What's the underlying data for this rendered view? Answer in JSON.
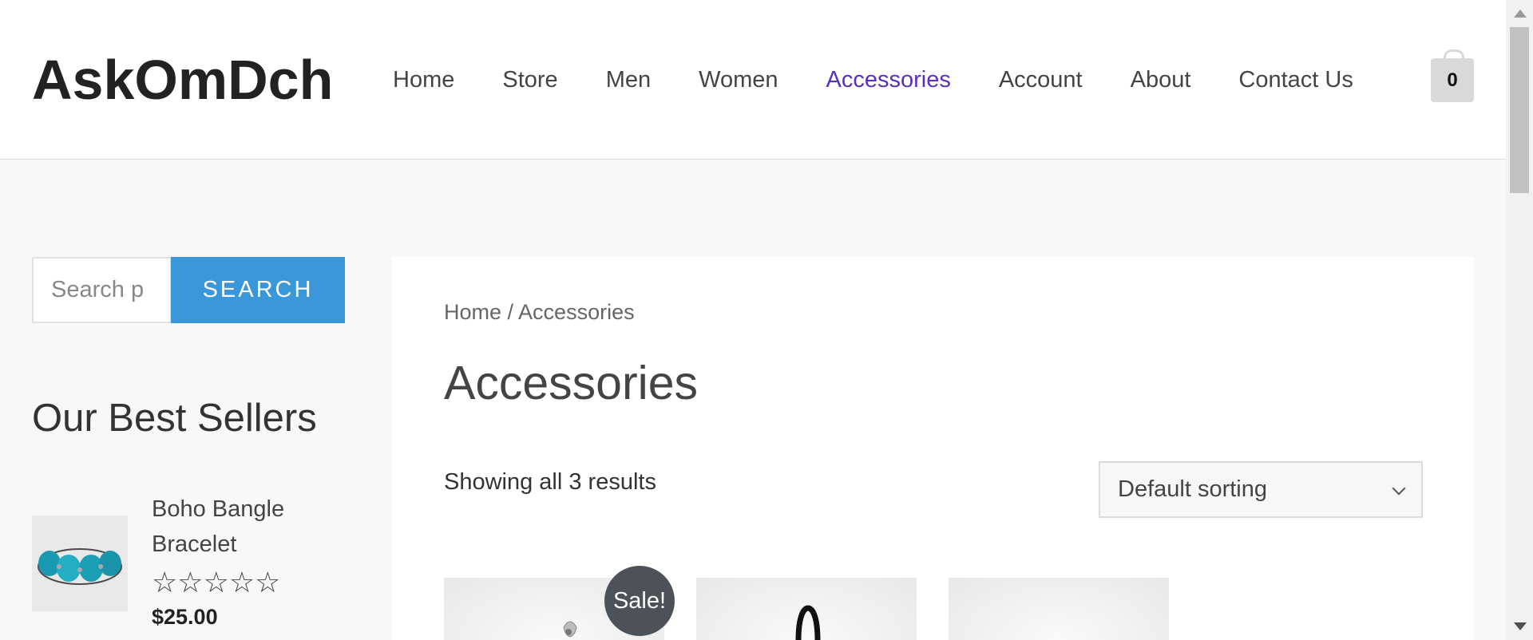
{
  "header": {
    "site_title": "AskOmDch",
    "nav": [
      {
        "label": "Home",
        "active": false
      },
      {
        "label": "Store",
        "active": false
      },
      {
        "label": "Men",
        "active": false
      },
      {
        "label": "Women",
        "active": false
      },
      {
        "label": "Accessories",
        "active": true
      },
      {
        "label": "Account",
        "active": false
      },
      {
        "label": "About",
        "active": false
      },
      {
        "label": "Contact Us",
        "active": false
      }
    ],
    "cart_count": "0"
  },
  "sidebar": {
    "search_placeholder": "Search p",
    "search_button": "SEARCH",
    "widget_title": "Our Best Sellers",
    "best_seller": {
      "name": "Boho Bangle Bracelet",
      "rating_stars": 0,
      "price": "$25.00"
    }
  },
  "main": {
    "breadcrumb_home": "Home",
    "breadcrumb_sep": " / ",
    "breadcrumb_current": "Accessories",
    "title": "Accessories",
    "result_count": "Showing all 3 results",
    "sort_selected": "Default sorting",
    "sale_badge": "Sale!"
  },
  "colors": {
    "accent_nav": "#5a2fbf",
    "search_button": "#3a97d9",
    "sale_badge": "#4c5258"
  }
}
